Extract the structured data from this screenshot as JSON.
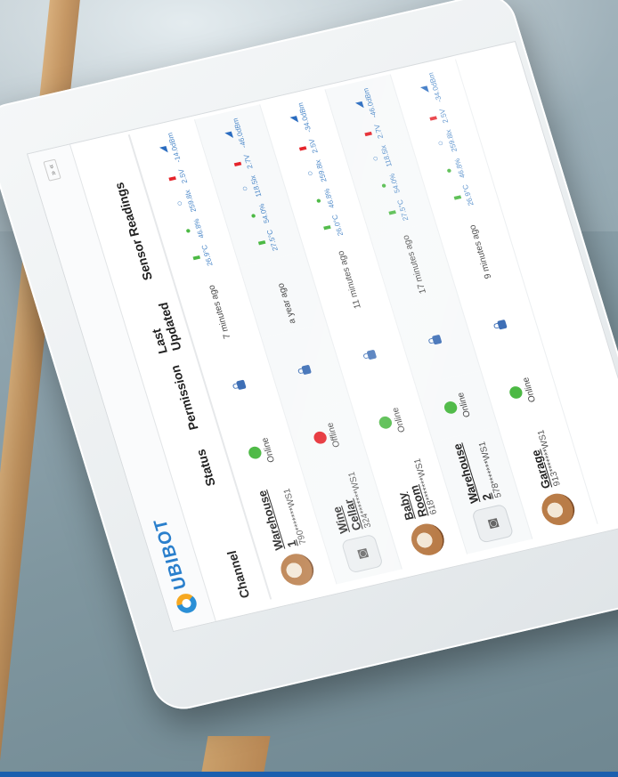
{
  "app": {
    "logo_text": "UBIBOT",
    "pager": "» «"
  },
  "columns": {
    "channel": "Channel",
    "status": "Status",
    "permission": "Permission",
    "updated": "Last Updated",
    "readings": "Sensor Readings"
  },
  "rows": [
    {
      "name": "Warehouse 1",
      "id": "790*******WS1",
      "thumb": "photo",
      "status": "Online",
      "status_color": "#4cb944",
      "updated": "7 minutes ago",
      "r": {
        "temp": "26.9°C",
        "hum": "46.8%",
        "lux": "259.8lx",
        "volt": "2.5V",
        "sig": "-14.0dBm"
      }
    },
    {
      "name": "Wine Cellar",
      "id": "324*******WS1",
      "thumb": "camera",
      "status": "Offline",
      "status_color": "#e5242b",
      "updated": "a year ago",
      "r": {
        "temp": "27.5°C",
        "hum": "54.0%",
        "lux": "118.5lx",
        "volt": "2.7V",
        "sig": "-46.0dBm"
      }
    },
    {
      "name": "Baby Room",
      "id": "618*******WS1",
      "thumb": "photo",
      "status": "Online",
      "status_color": "#4cb944",
      "updated": "11 minutes ago",
      "r": {
        "temp": "26.0°C",
        "hum": "46.8%",
        "lux": "259.8lx",
        "volt": "2.5V",
        "sig": "-34.0dBm"
      }
    },
    {
      "name": "Warehouse 2",
      "id": "578*******WS1",
      "thumb": "camera",
      "status": "Online",
      "status_color": "#4cb944",
      "updated": "17 minutes ago",
      "r": {
        "temp": "27.5°C",
        "hum": "54.0%",
        "lux": "118.5lx",
        "volt": "2.7V",
        "sig": "-46.0dBm"
      }
    },
    {
      "name": "Garage",
      "id": "913*******WS1",
      "thumb": "photo",
      "status": "Online",
      "status_color": "#4cb944",
      "updated": "9 minutes ago",
      "r": {
        "temp": "26.9°C",
        "hum": "46.8%",
        "lux": "259.8lx",
        "volt": "2.5V",
        "sig": "-34.0dBm"
      }
    }
  ]
}
